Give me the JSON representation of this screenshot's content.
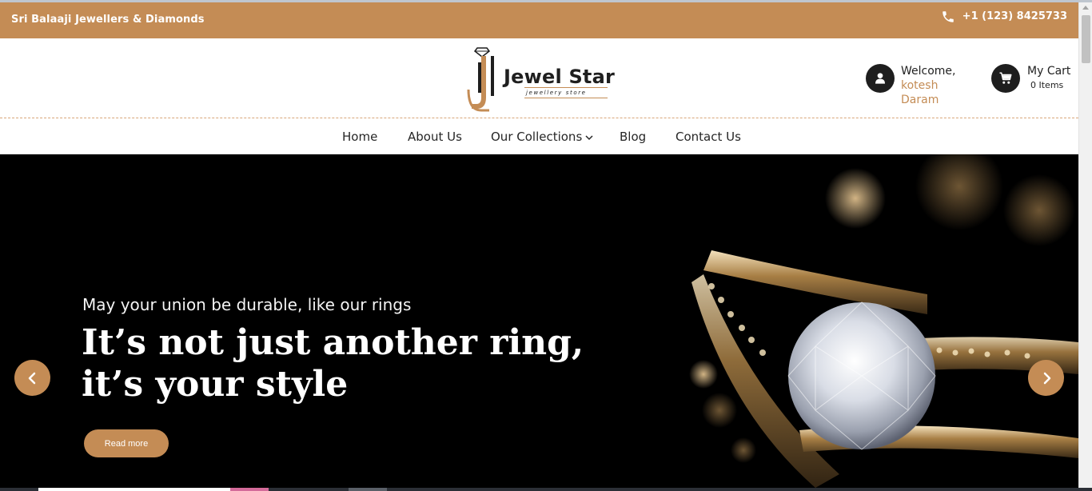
{
  "topbar": {
    "shop_name": "Sri Balaaji Jewellers & Diamonds",
    "phone_icon": "phone-icon",
    "phone": "+1 (123) 8425733"
  },
  "header": {
    "logo": {
      "brand": "Jewel Star",
      "tagline": "jewellery store"
    },
    "user": {
      "icon": "user-icon",
      "welcome": "Welcome,",
      "name": "kotesh Daram"
    },
    "cart": {
      "icon": "cart-icon",
      "label": "My Cart",
      "count": "0 Items"
    }
  },
  "nav": {
    "items": [
      {
        "label": "Home"
      },
      {
        "label": "About Us"
      },
      {
        "label": "Our Collections",
        "icon": "chevron-down-icon"
      },
      {
        "label": "Blog"
      },
      {
        "label": "Contact Us"
      }
    ]
  },
  "hero": {
    "subtitle": "May your union be durable, like our rings",
    "headline_line1": "It’s not just another ring,",
    "headline_line2": "it’s your style",
    "cta": "Read more",
    "prev_icon": "chevron-left-icon",
    "next_icon": "chevron-right-icon"
  },
  "colors": {
    "accent": "#c48c55",
    "dark": "#1e1e1e",
    "hero_bg": "#000000"
  }
}
